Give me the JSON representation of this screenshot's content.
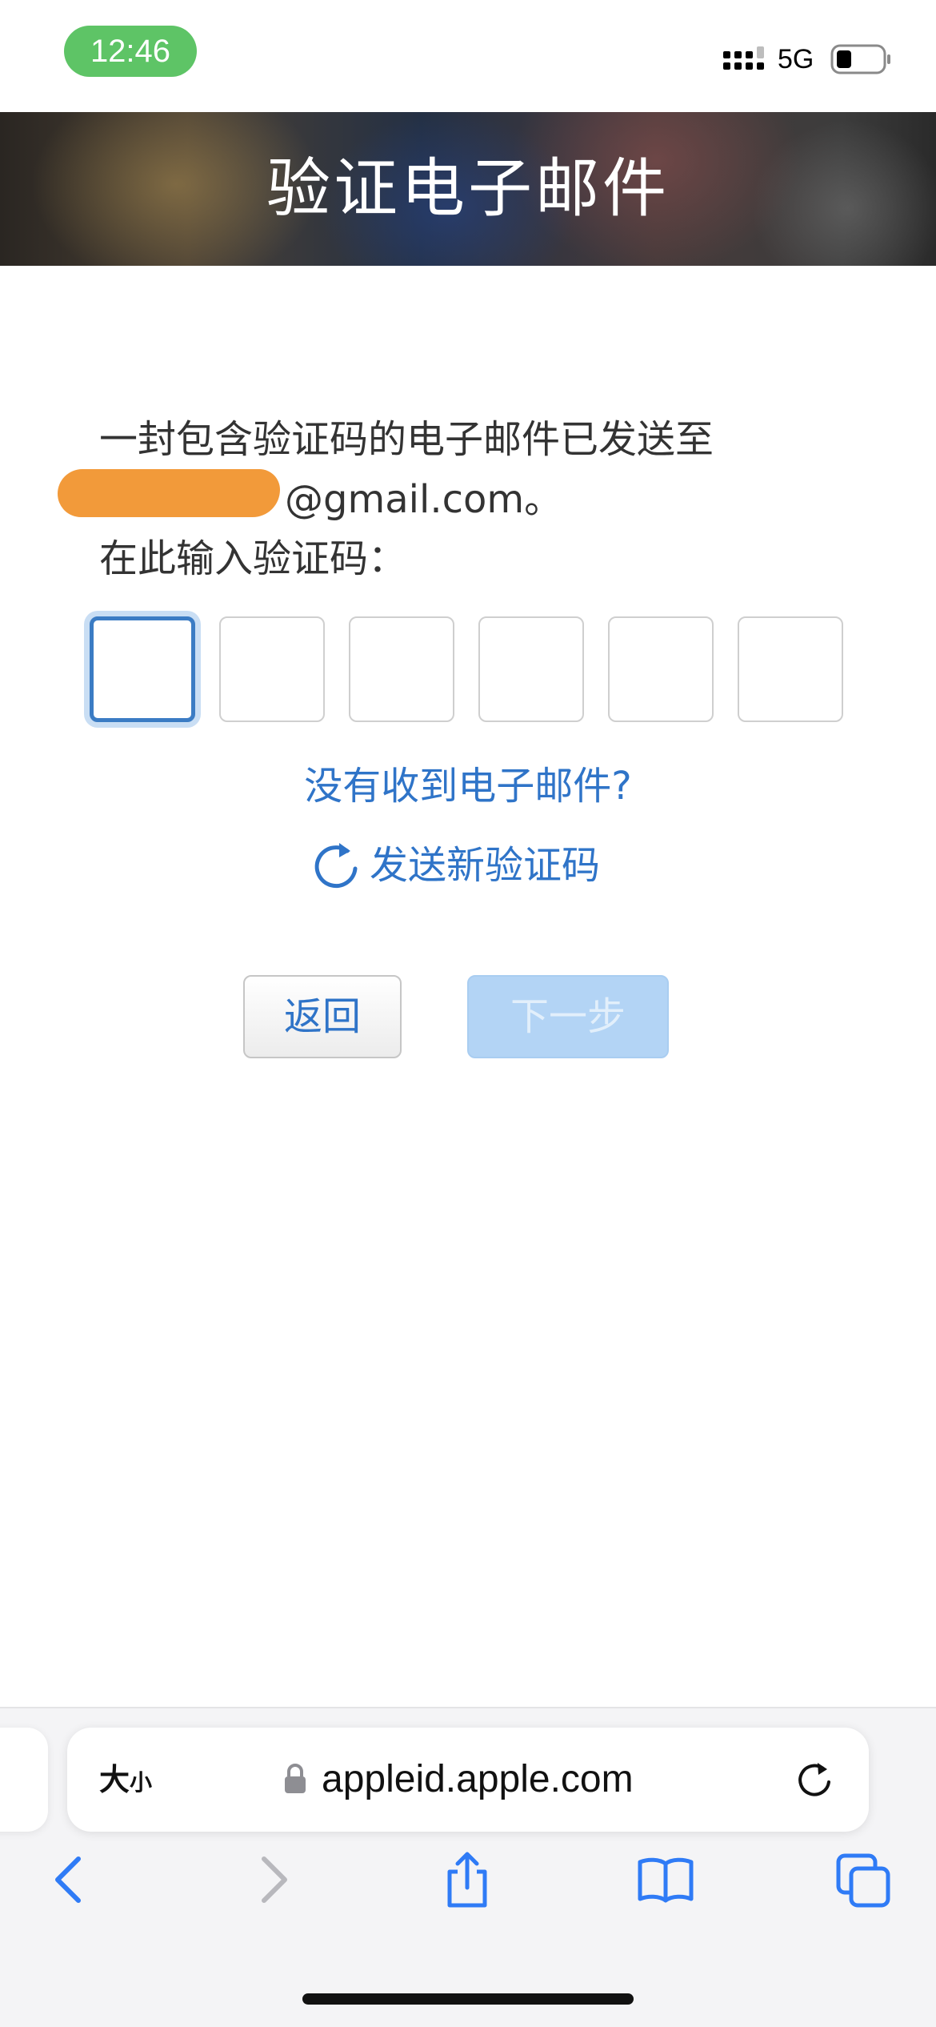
{
  "status_bar": {
    "time": "12:46",
    "network": "5G",
    "signal_icon": "cellular-signal-icon",
    "battery_icon": "battery-icon"
  },
  "header": {
    "title": "验证电子邮件"
  },
  "message": {
    "line1": "一封包含验证码的电子邮件已发送至",
    "email_suffix": "@gmail.com。",
    "line3": "在此输入验证码："
  },
  "code_inputs": [
    {
      "value": ""
    },
    {
      "value": ""
    },
    {
      "value": ""
    },
    {
      "value": ""
    },
    {
      "value": ""
    },
    {
      "value": ""
    }
  ],
  "links": {
    "no_email": "没有收到电子邮件?",
    "resend": "发送新验证码"
  },
  "buttons": {
    "back": "返回",
    "next": "下一步"
  },
  "browser": {
    "text_size_big": "大",
    "text_size_small": "小",
    "url": "appleid.apple.com"
  },
  "colors": {
    "link_blue": "#2f74c8",
    "active_border": "#3b7cc4",
    "time_pill": "#5ec466",
    "redaction": "#f29a3a",
    "next_disabled": "#b3d4f5"
  }
}
